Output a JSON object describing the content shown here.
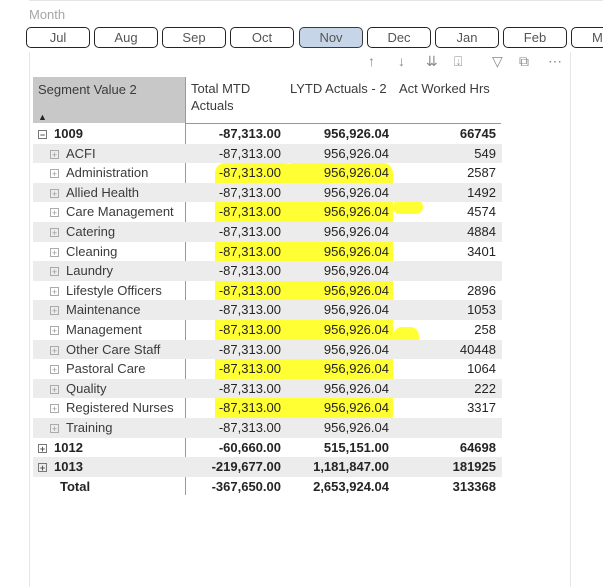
{
  "slicer": {
    "title": "Month",
    "months": [
      "Jul",
      "Aug",
      "Sep",
      "Oct",
      "Nov",
      "Dec",
      "Jan",
      "Feb",
      "M"
    ],
    "selected": "Nov"
  },
  "toolbar": {
    "icons": [
      "arrow-up-icon",
      "arrow-down-icon",
      "double-arrow-down-icon",
      "expand-hierarchy-icon",
      "filter-icon",
      "focus-mode-icon",
      "more-options-icon"
    ]
  },
  "matrix": {
    "headers": {
      "segment": "Segment Value 2",
      "total_mtd": "Total MTD Actuals",
      "lytd": "LYTD Actuals - 2",
      "hours": "Act Worked Hrs"
    },
    "rows": [
      {
        "level": 0,
        "expander": "⊟",
        "label": "1009",
        "total": "-87,313.00",
        "lytd": "956,926.04",
        "hours": "66745",
        "bold": true,
        "shaded": false
      },
      {
        "level": 1,
        "expander": "⊞",
        "label": "ACFI",
        "total": "-87,313.00",
        "lytd": "956,926.04",
        "hours": "549",
        "bold": false,
        "shaded": true
      },
      {
        "level": 1,
        "expander": "⊞",
        "label": "Administration",
        "total": "-87,313.00",
        "lytd": "956,926.04",
        "hours": "2587",
        "bold": false,
        "shaded": false
      },
      {
        "level": 1,
        "expander": "⊞",
        "label": "Allied Health",
        "total": "-87,313.00",
        "lytd": "956,926.04",
        "hours": "1492",
        "bold": false,
        "shaded": true
      },
      {
        "level": 1,
        "expander": "⊞",
        "label": "Care Management",
        "total": "-87,313.00",
        "lytd": "956,926.04",
        "hours": "4574",
        "bold": false,
        "shaded": false
      },
      {
        "level": 1,
        "expander": "⊞",
        "label": "Catering",
        "total": "-87,313.00",
        "lytd": "956,926.04",
        "hours": "4884",
        "bold": false,
        "shaded": true
      },
      {
        "level": 1,
        "expander": "⊞",
        "label": "Cleaning",
        "total": "-87,313.00",
        "lytd": "956,926.04",
        "hours": "3401",
        "bold": false,
        "shaded": false
      },
      {
        "level": 1,
        "expander": "⊞",
        "label": "Laundry",
        "total": "-87,313.00",
        "lytd": "956,926.04",
        "hours": "",
        "bold": false,
        "shaded": true
      },
      {
        "level": 1,
        "expander": "⊞",
        "label": "Lifestyle Officers",
        "total": "-87,313.00",
        "lytd": "956,926.04",
        "hours": "2896",
        "bold": false,
        "shaded": false
      },
      {
        "level": 1,
        "expander": "⊞",
        "label": "Maintenance",
        "total": "-87,313.00",
        "lytd": "956,926.04",
        "hours": "1053",
        "bold": false,
        "shaded": true
      },
      {
        "level": 1,
        "expander": "⊞",
        "label": "Management",
        "total": "-87,313.00",
        "lytd": "956,926.04",
        "hours": "258",
        "bold": false,
        "shaded": false
      },
      {
        "level": 1,
        "expander": "⊞",
        "label": "Other Care Staff",
        "total": "-87,313.00",
        "lytd": "956,926.04",
        "hours": "40448",
        "bold": false,
        "shaded": true
      },
      {
        "level": 1,
        "expander": "⊞",
        "label": "Pastoral Care",
        "total": "-87,313.00",
        "lytd": "956,926.04",
        "hours": "1064",
        "bold": false,
        "shaded": false
      },
      {
        "level": 1,
        "expander": "⊞",
        "label": "Quality",
        "total": "-87,313.00",
        "lytd": "956,926.04",
        "hours": "222",
        "bold": false,
        "shaded": true
      },
      {
        "level": 1,
        "expander": "⊞",
        "label": "Registered Nurses",
        "total": "-87,313.00",
        "lytd": "956,926.04",
        "hours": "3317",
        "bold": false,
        "shaded": false
      },
      {
        "level": 1,
        "expander": "⊞",
        "label": "Training",
        "total": "-87,313.00",
        "lytd": "956,926.04",
        "hours": "",
        "bold": false,
        "shaded": true
      },
      {
        "level": 0,
        "expander": "⊞",
        "label": "1012",
        "total": "-60,660.00",
        "lytd": "515,151.00",
        "hours": "64698",
        "bold": true,
        "shaded": false
      },
      {
        "level": 0,
        "expander": "⊞",
        "label": "1013",
        "total": "-219,677.00",
        "lytd": "1,181,847.00",
        "hours": "181925",
        "bold": true,
        "shaded": true
      },
      {
        "level": -1,
        "expander": "",
        "label": "Total",
        "total": "-367,650.00",
        "lytd": "2,653,924.04",
        "hours": "313368",
        "bold": true,
        "shaded": false
      }
    ]
  },
  "highlight_color": "#ffff33",
  "selected_color": "#c6d5e8"
}
